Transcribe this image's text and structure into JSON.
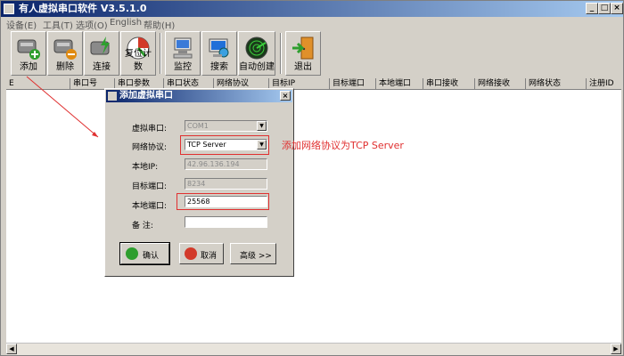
{
  "window": {
    "title": "有人虚拟串口软件 V3.5.1.0"
  },
  "menu": [
    "设备(E)",
    "工具(T)",
    "选项(O)",
    "English",
    "帮助(H)"
  ],
  "toolbar": {
    "add": "添加",
    "remove": "删除",
    "connect": "连接",
    "reset": "复位计数",
    "monitor": "监控",
    "search": "搜索",
    "auto_create": "自动创建",
    "exit": "退出"
  },
  "columns": [
    "E",
    "串口号",
    "串口参数",
    "串口状态",
    "网络协议",
    "目标IP",
    "目标端口",
    "本地端口",
    "串口接收",
    "网络接收",
    "网络状态",
    "注册ID"
  ],
  "dialog": {
    "title": "添加虚拟串口",
    "virtual_port_label": "虚拟串口:",
    "virtual_port_value": "COM1",
    "protocol_label": "网络协议:",
    "protocol_value": "TCP Server",
    "local_ip_label": "本地IP:",
    "local_ip_value": "42.96.136.194",
    "target_port_label": "目标端口:",
    "target_port_value": "8234",
    "local_port_label": "本地端口:",
    "local_port_value": "25568",
    "note_label": "备  注:",
    "note_value": "",
    "ok": "确认",
    "cancel": "取消",
    "advanced": "高级 >>"
  },
  "annotation": "添加网络协议为TCP Server",
  "colors": {
    "title_start": "#0a246a",
    "title_end": "#a6caf0",
    "face": "#d4d0c8",
    "annotation": "#e03030"
  }
}
